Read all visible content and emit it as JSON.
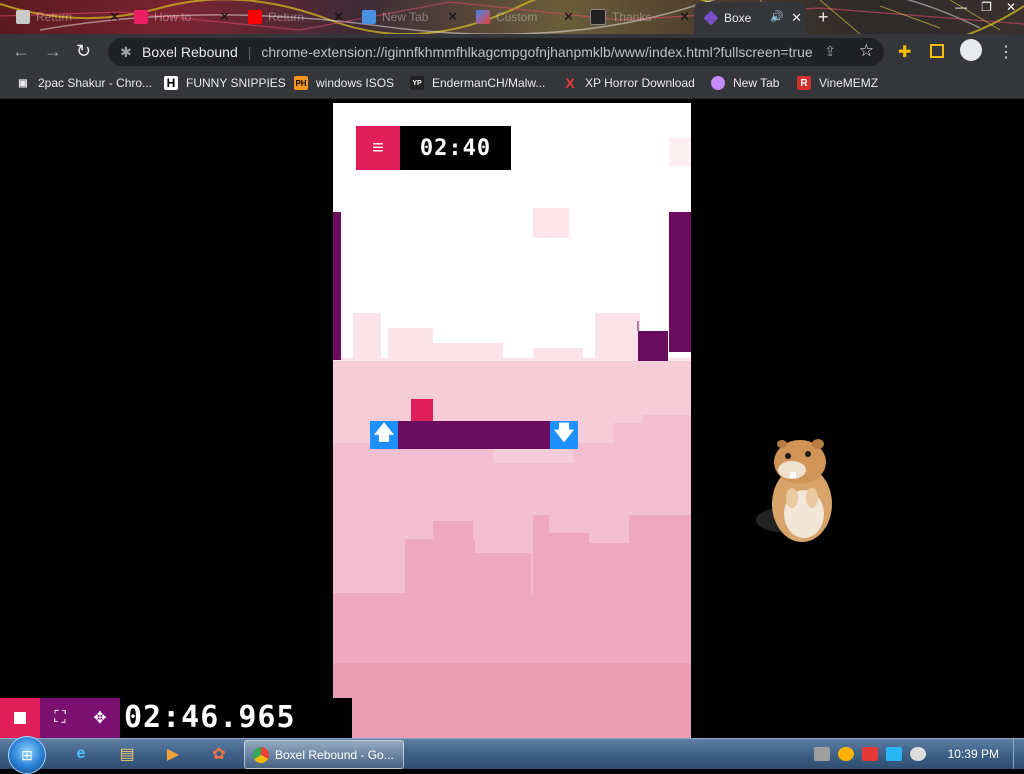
{
  "browser": {
    "tabs": [
      {
        "label": "Return",
        "active": false
      },
      {
        "label": "How to",
        "active": false
      },
      {
        "label": "Return",
        "active": false
      },
      {
        "label": "New Tab",
        "active": false
      },
      {
        "label": "Custom",
        "active": false
      },
      {
        "label": "Thanks",
        "active": false
      },
      {
        "label": "Boxe",
        "active": true
      }
    ],
    "new_tab_symbol": "+",
    "page_title": "Boxel Rebound",
    "url": "chrome-extension://iginnfkhmmfhlkagcmpgofnjhanpmklb/www/index.html?fullscreen=true",
    "bookmarks": [
      {
        "label": "2pac Shakur - Chro...",
        "icon": "store-icon",
        "glyph": "▣",
        "color": "#e8eaed"
      },
      {
        "label": "FUNNY SNIPPIES",
        "icon": "h-icon",
        "glyph": "H",
        "color": "#ffffff"
      },
      {
        "label": "windows ISOS",
        "icon": "ph-icon",
        "glyph": "PH",
        "color": "#f7971d"
      },
      {
        "label": "EndermanCH/Malw...",
        "icon": "yp-icon",
        "glyph": "YP",
        "color": "#ffffff"
      },
      {
        "label": "XP Horror Download",
        "icon": "x-icon",
        "glyph": "X",
        "color": "#e53935"
      },
      {
        "label": "New Tab",
        "icon": "globe-icon",
        "glyph": "◍",
        "color": "#c58af9"
      },
      {
        "label": "VineMEMZ",
        "icon": "r-icon",
        "glyph": "R",
        "color": "#d32f2f"
      }
    ]
  },
  "game": {
    "menu_symbol": "≡",
    "timer": "02:40",
    "arrow_up": "🡅",
    "arrow_down": "🡇",
    "colors": {
      "accent": "#e01e5a",
      "wall": "#6b0d5f",
      "platform": "#6b0d5f",
      "player": "#e01e5a",
      "arrow": "#1e90ff"
    }
  },
  "speedrun": {
    "time": "02:46.965",
    "buttons": [
      "stop-icon",
      "fullscreen-icon",
      "exit-fullscreen-icon"
    ]
  },
  "taskbar": {
    "chrome_task_label": "Boxel Rebound - Go...",
    "clock": "10:39 PM"
  }
}
